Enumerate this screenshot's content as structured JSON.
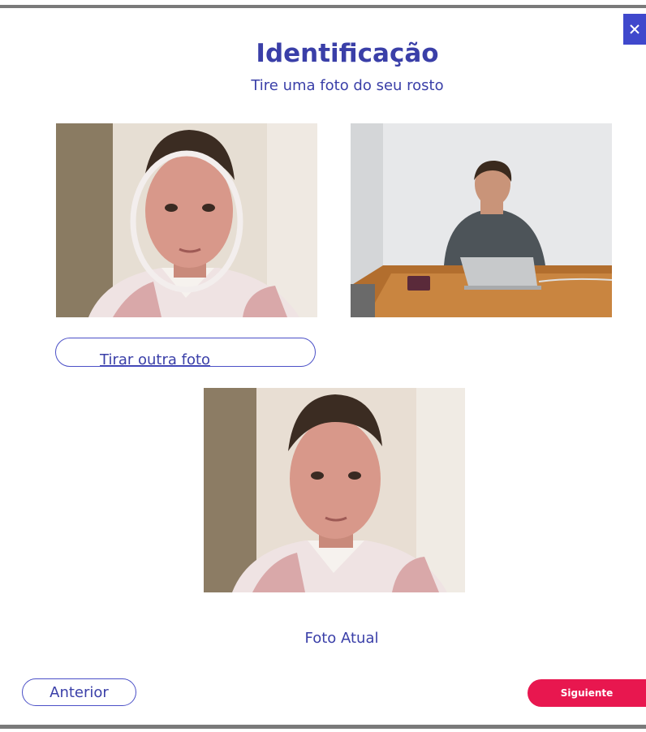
{
  "dialog": {
    "title": "Identificação",
    "subtitle": "Tire uma foto do seu rosto",
    "close_icon": "close-icon"
  },
  "photos": {
    "captured_alt": "Foto capturada",
    "example_alt": "Exemplo",
    "current_alt": "Foto Atual"
  },
  "actions": {
    "retake_label": "Tirar outra foto",
    "current_photo_label": "Foto Atual",
    "previous_label": "Anterior",
    "next_label": "Siguiente"
  },
  "colors": {
    "accent": "#3f48cc",
    "primary_button": "#e8174f",
    "text": "#3a3fa8"
  }
}
